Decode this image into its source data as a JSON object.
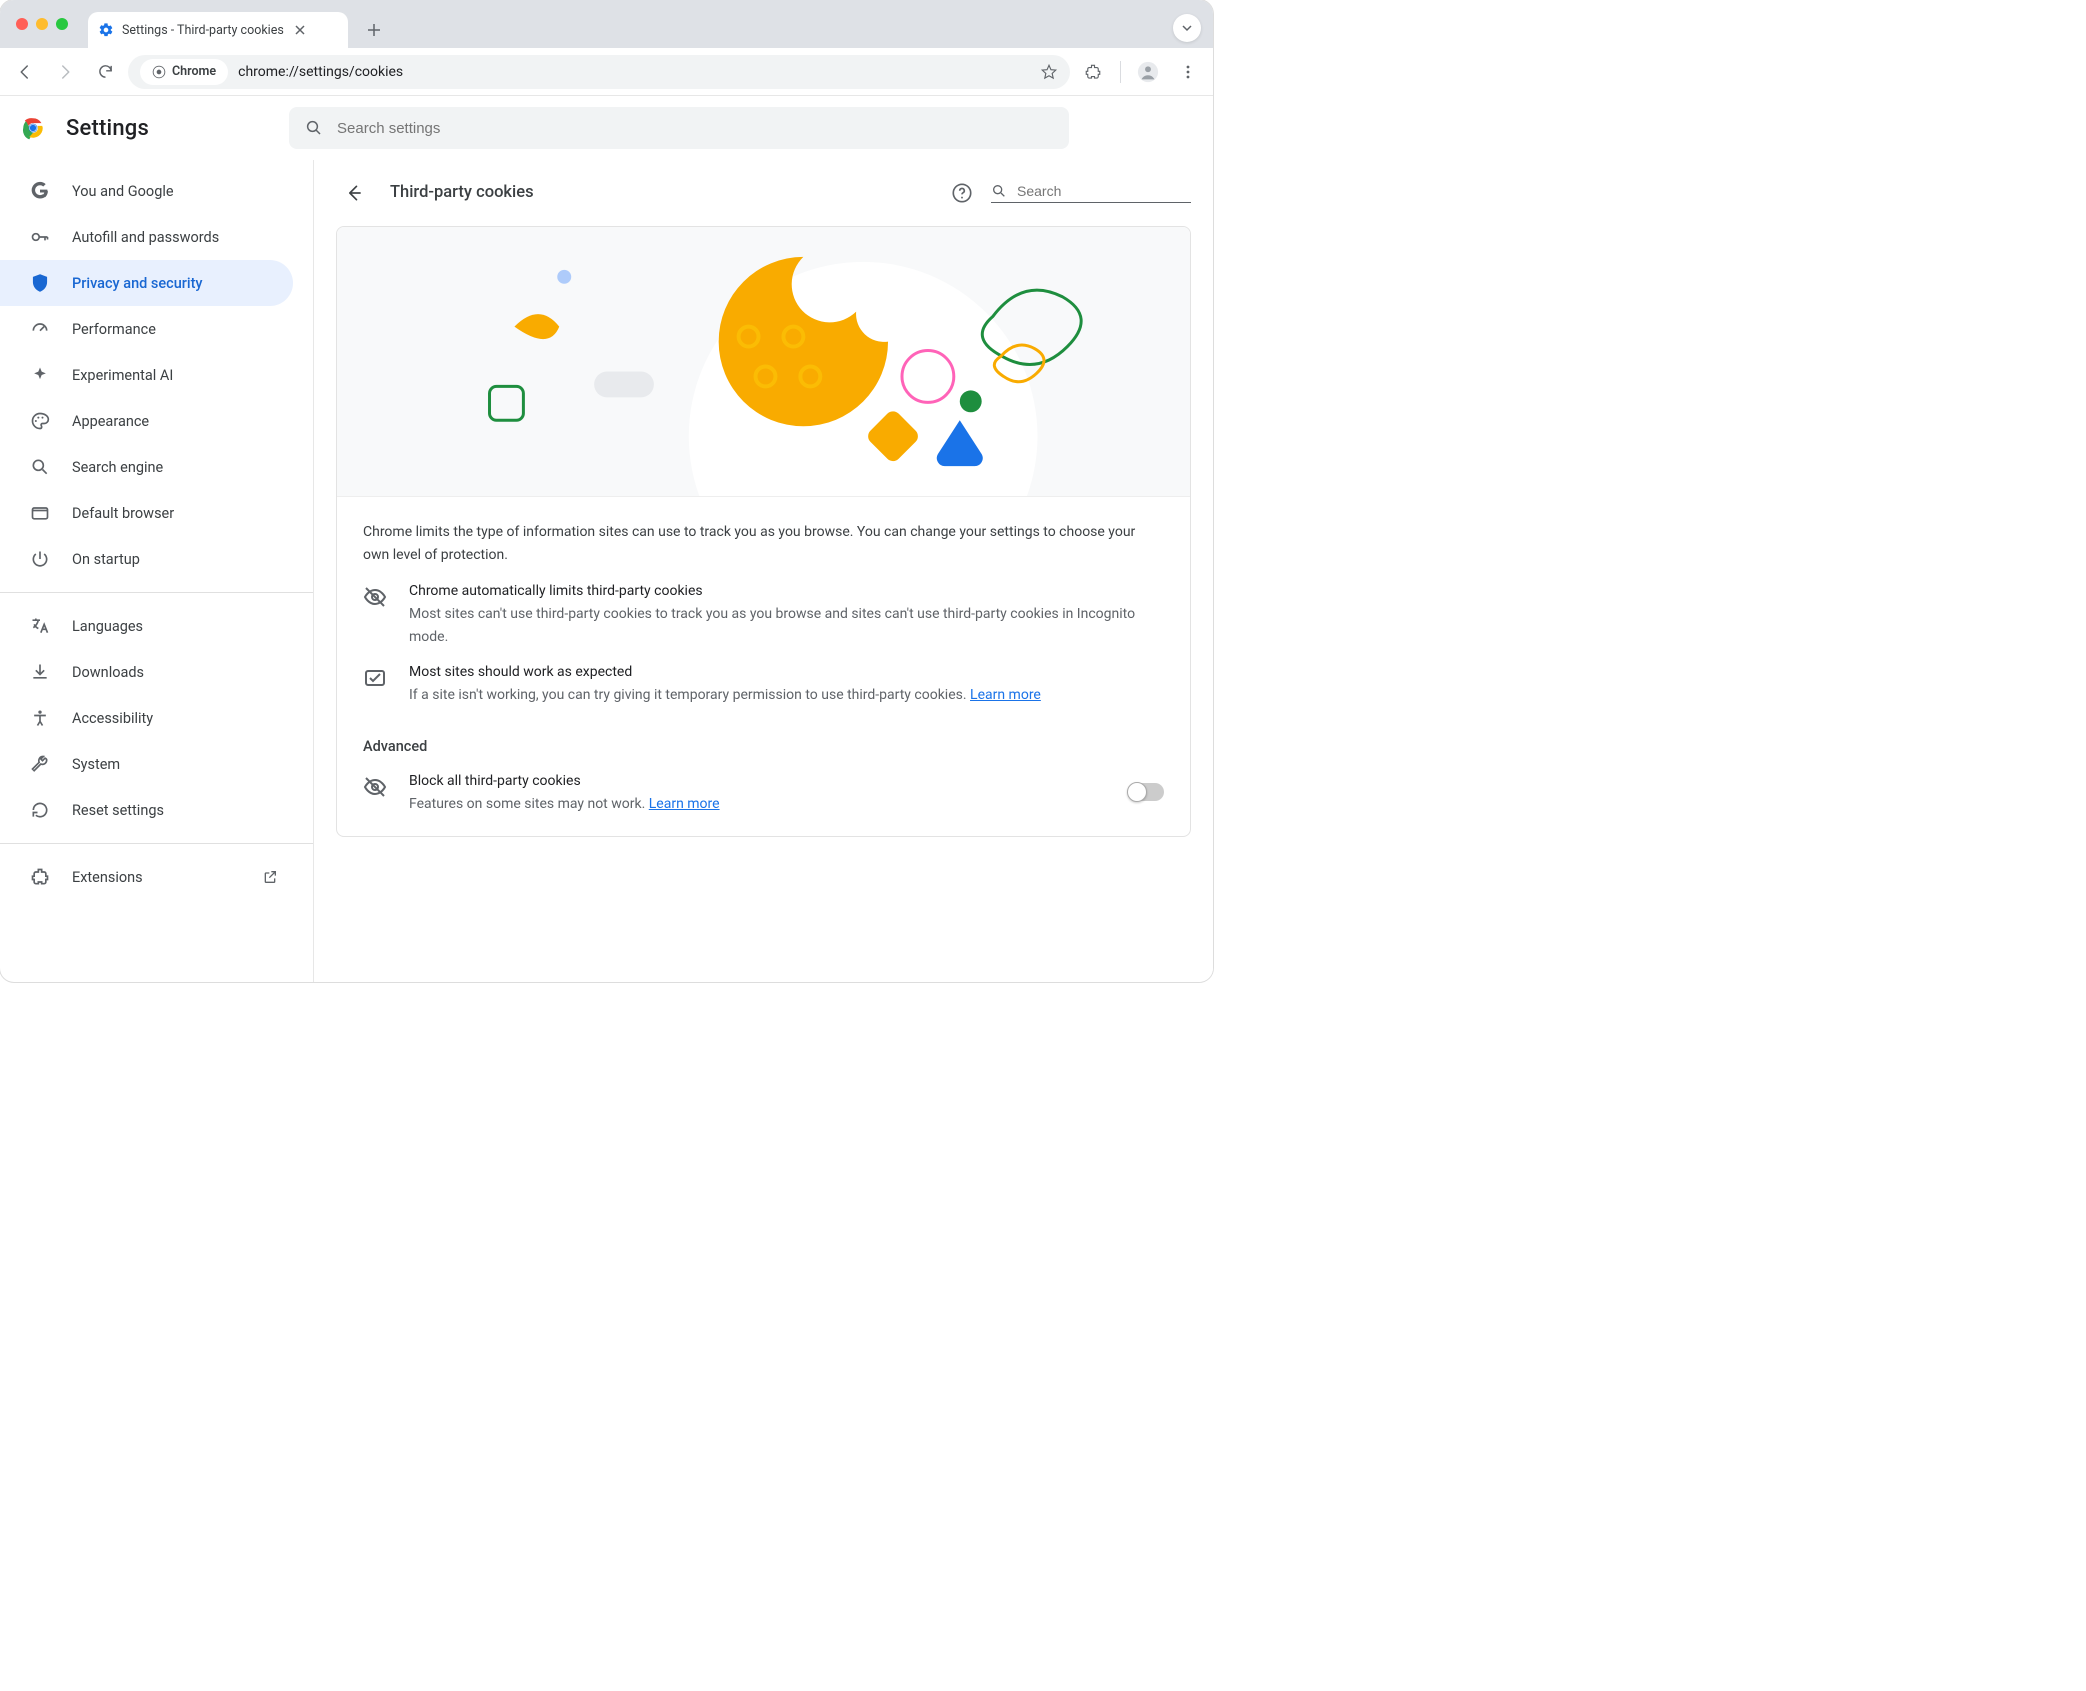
{
  "tab": {
    "title": "Settings - Third-party cookies"
  },
  "omnibox": {
    "chip": "Chrome",
    "url": "chrome://settings/cookies"
  },
  "header": {
    "title": "Settings",
    "search_placeholder": "Search settings"
  },
  "sidebar": {
    "items": [
      {
        "icon": "google",
        "label": "You and Google"
      },
      {
        "icon": "key",
        "label": "Autofill and passwords"
      },
      {
        "icon": "shield",
        "label": "Privacy and security"
      },
      {
        "icon": "gauge",
        "label": "Performance"
      },
      {
        "icon": "spark",
        "label": "Experimental AI"
      },
      {
        "icon": "palette",
        "label": "Appearance"
      },
      {
        "icon": "search",
        "label": "Search engine"
      },
      {
        "icon": "tab",
        "label": "Default browser"
      },
      {
        "icon": "power",
        "label": "On startup"
      }
    ],
    "advanced": [
      {
        "icon": "lang",
        "label": "Languages"
      },
      {
        "icon": "download",
        "label": "Downloads"
      },
      {
        "icon": "a11y",
        "label": "Accessibility"
      },
      {
        "icon": "wrench",
        "label": "System"
      },
      {
        "icon": "reset",
        "label": "Reset settings"
      }
    ],
    "footer": {
      "icon": "puzzle",
      "label": "Extensions"
    }
  },
  "main": {
    "subpage_title": "Third-party cookies",
    "search_placeholder": "Search",
    "intro": "Chrome limits the type of information sites can use to track you as you browse. You can change your settings to choose your own level of protection.",
    "info1": {
      "title": "Chrome automatically limits third-party cookies",
      "sub": "Most sites can't use third-party cookies to track you as you browse and sites can't use third-party cookies in Incognito mode."
    },
    "info2": {
      "title": "Most sites should work as expected",
      "sub": "If a site isn't working, you can try giving it temporary permission to use third-party cookies. ",
      "link": "Learn more"
    },
    "advanced_label": "Advanced",
    "block_row": {
      "title": "Block all third-party cookies",
      "sub": "Features on some sites may not work. ",
      "link": "Learn more"
    }
  }
}
